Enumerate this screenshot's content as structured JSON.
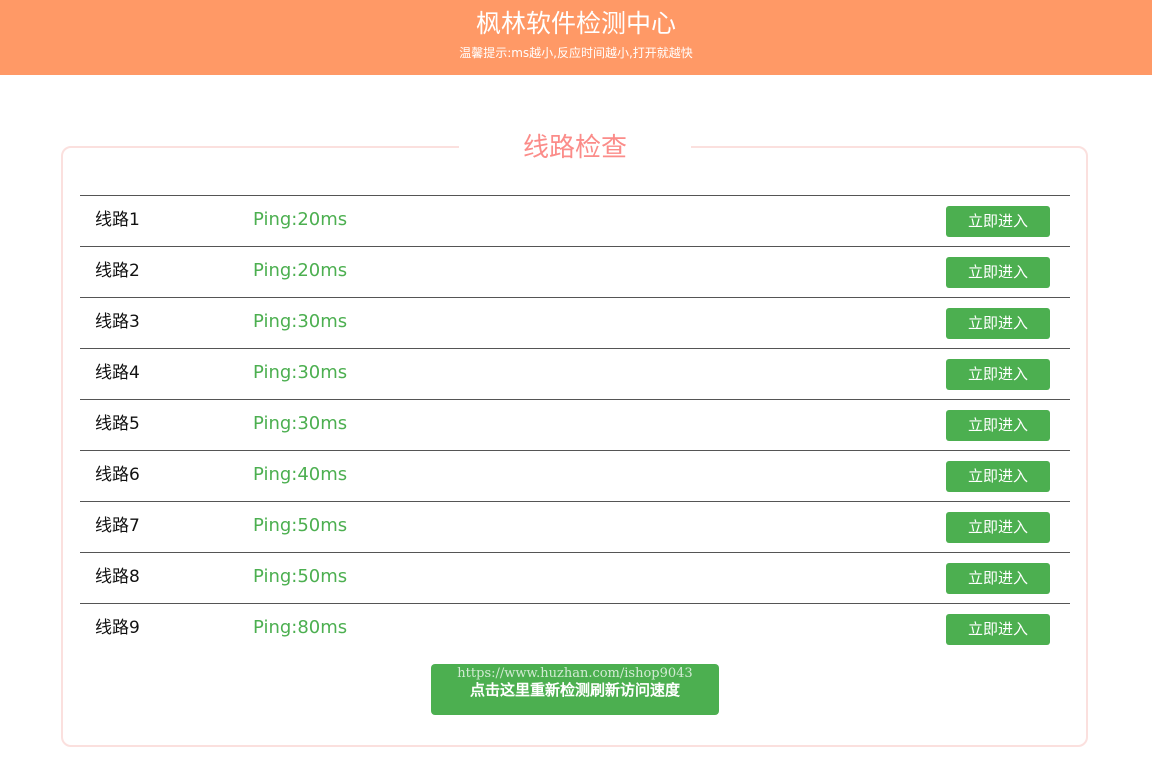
{
  "header": {
    "title": "枫林软件检测中心",
    "tip": "温馨提示:ms越小,反应时间越小,打开就越快"
  },
  "panel": {
    "title": "线路检查"
  },
  "lines": [
    {
      "name": "线路1",
      "ping": "Ping:20ms",
      "button": "立即进入"
    },
    {
      "name": "线路2",
      "ping": "Ping:20ms",
      "button": "立即进入"
    },
    {
      "name": "线路3",
      "ping": "Ping:30ms",
      "button": "立即进入"
    },
    {
      "name": "线路4",
      "ping": "Ping:30ms",
      "button": "立即进入"
    },
    {
      "name": "线路5",
      "ping": "Ping:30ms",
      "button": "立即进入"
    },
    {
      "name": "线路6",
      "ping": "Ping:40ms",
      "button": "立即进入"
    },
    {
      "name": "线路7",
      "ping": "Ping:50ms",
      "button": "立即进入"
    },
    {
      "name": "线路8",
      "ping": "Ping:50ms",
      "button": "立即进入"
    },
    {
      "name": "线路9",
      "ping": "Ping:80ms",
      "button": "立即进入"
    }
  ],
  "refresh": {
    "watermark": "https://www.huzhan.com/ishop9043",
    "label": "点击这里重新检测刷新访问速度"
  },
  "colors": {
    "header_bg": "#ff9966",
    "accent_green": "#4caf50",
    "panel_title": "#fb8c89",
    "panel_border": "#fbe0de"
  }
}
